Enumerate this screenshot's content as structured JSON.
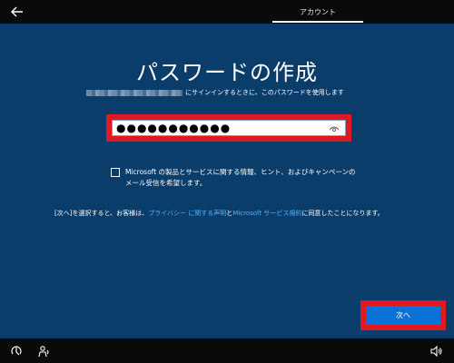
{
  "header": {
    "back_icon": "back-arrow-icon",
    "tab_label": "アカウント"
  },
  "main": {
    "title": "パスワードの作成",
    "subtitle_suffix": "にサインインするときに、このパスワードを使用します",
    "password": {
      "masked_value": "●●●●●●●●●●●",
      "reveal_icon": "eye-icon"
    },
    "marketing_checkbox": {
      "checked": false,
      "label": "Microsoft の製品とサービスに関する情報、ヒント、およびキャンペーンのメール受信を希望します。"
    },
    "legal": {
      "prefix": "[次へ]を選択すると、お客様は、",
      "privacy_link": "プライバシー に関する声明",
      "connector": "と",
      "terms_link": "Microsoft サービス規約",
      "suffix": "に同意したことになります。"
    },
    "next_button_label": "次へ"
  },
  "footer": {
    "ease_of_access_icon": "ease-of-access-icon",
    "accessibility_icon": "narrator-icon",
    "volume_icon": "volume-icon"
  },
  "colors": {
    "background": "#0b3d6b",
    "highlight": "#e0191e",
    "button": "#0a72d6",
    "link": "#4fb3ff"
  }
}
